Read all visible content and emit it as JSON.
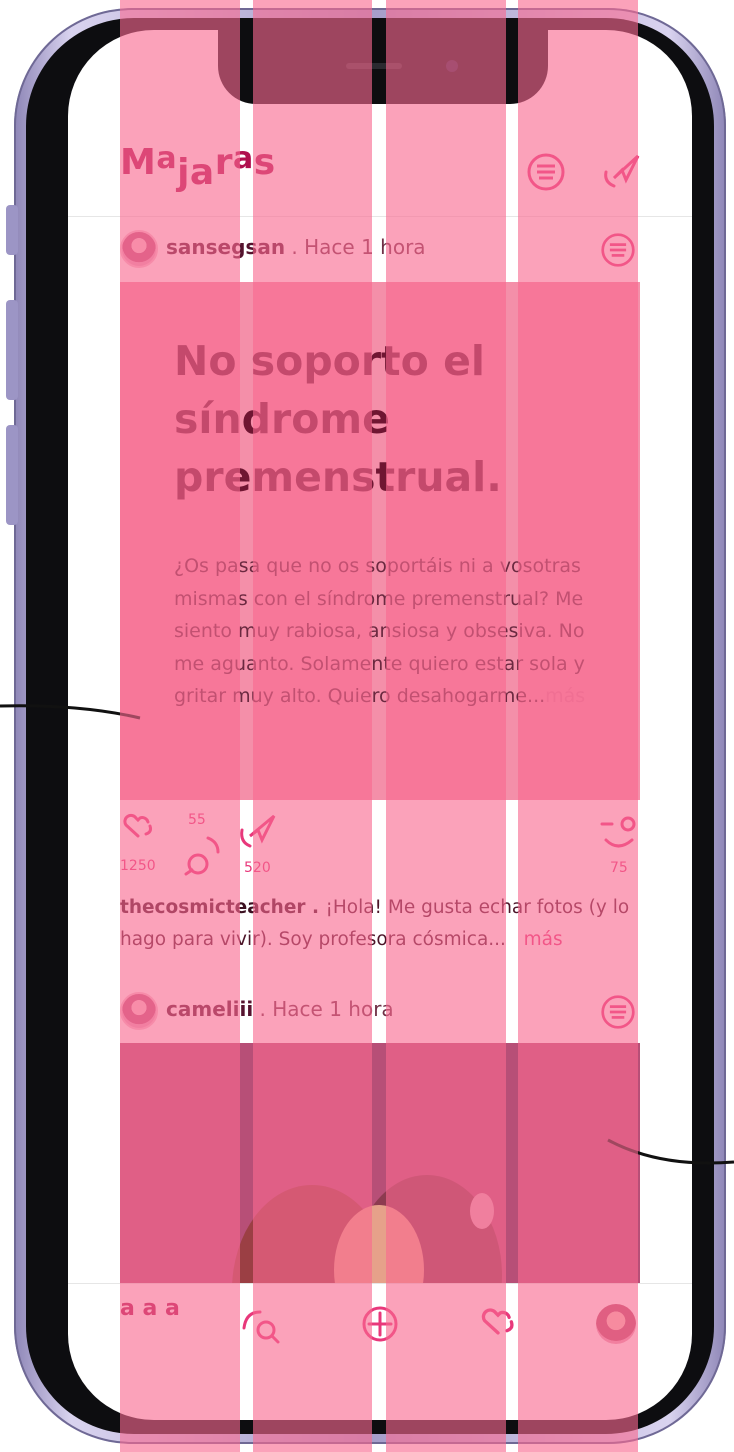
{
  "app": {
    "title": "Majaras",
    "logo_parts": [
      "M",
      "a",
      "j",
      "a",
      "r",
      "a",
      "s"
    ]
  },
  "header": {
    "menu_icon": "list-circle-icon",
    "share_icon": "send-icon"
  },
  "post1": {
    "username": "sansegsan",
    "time": " . Hace 1 hora",
    "title": "No soporto el síndrome premenstrual.",
    "body": "¿Os pasa que no os soportáis ni a vosotras mismas con el síndrome premenstrual? Me siento muy rabiosa, ansiosa y obsesiva. No me aguanto. Solamente quiero estar sola y gritar muy alto. Quiero desahogarme...",
    "more": "más",
    "likes": "1250",
    "comments": "55",
    "shares": "520",
    "reactions": "75"
  },
  "caption": {
    "username": "thecosmicteacher",
    "separator": " . ",
    "text": "¡Hola! Me gusta echar fotos (y lo hago para vivir). Soy profesora cósmica...",
    "more": "más"
  },
  "post2": {
    "username": "cameliii",
    "time": " . Hace 1 hora"
  },
  "tabbar": {
    "items": [
      {
        "label": "a a a",
        "icon": "text-aa-icon"
      },
      {
        "icon": "search-icon"
      },
      {
        "icon": "add-circle-icon"
      },
      {
        "icon": "heart-icon"
      },
      {
        "icon": "profile-avatar"
      }
    ]
  },
  "colors": {
    "accent": "#e8387b",
    "brand": "#b0104f",
    "card": "#f48fa9",
    "overlay": "#f8698f"
  }
}
